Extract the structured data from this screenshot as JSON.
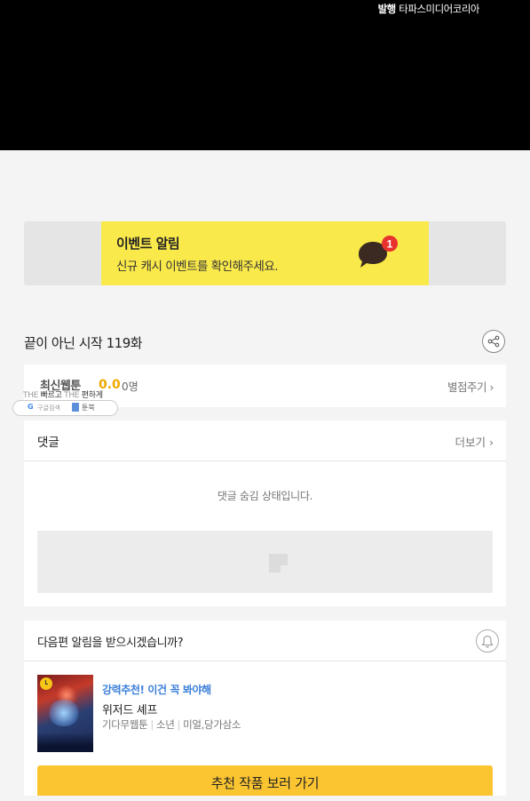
{
  "header": {
    "publisher_label": "발행",
    "publisher_name": "타파스미디어코리아"
  },
  "event": {
    "title": "이벤트 알림",
    "subtitle": "신규 캐시 이벤트를 확인해주세요.",
    "badge_count": "1"
  },
  "episode": {
    "title": "끝이 아닌 시작 119화"
  },
  "rating": {
    "label": "최신웹툰",
    "score": "0.0",
    "count": "0명",
    "rate_link": "별점주기"
  },
  "extension": {
    "line_prefix1": "THE",
    "line_word1": "빠르고",
    "line_prefix2": "THE",
    "line_word2": "편하게",
    "google_logo": "G",
    "google_label": "구글검색",
    "toon_label": "툰북"
  },
  "comments": {
    "title": "댓글",
    "more_label": "더보기",
    "hidden_message": "댓글 숨김 상태입니다."
  },
  "notify": {
    "question": "다음편 알림을 받으시겠습니까?"
  },
  "recommend": {
    "tag": "강력추천! 이건 꼭 봐야해",
    "title": "위저드 셰프",
    "meta": [
      "기다무웹툰",
      "소년",
      "미얼,당가삼소"
    ],
    "button_label": "추천 작품 보러 가기"
  },
  "colors": {
    "event_banner": "#fae94a",
    "rating_score": "#f0a800",
    "recommend_tag": "#3b7fd8",
    "recommend_button": "#fbc531"
  }
}
